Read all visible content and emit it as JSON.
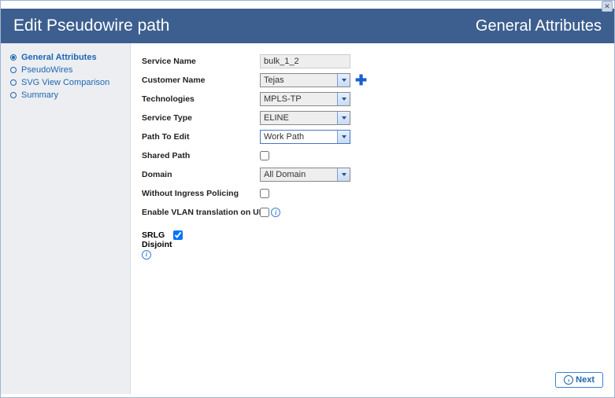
{
  "window": {
    "title": "Edit Pseudowire path",
    "section": "General Attributes"
  },
  "sidebar": {
    "items": [
      {
        "label": "General Attributes",
        "active": true
      },
      {
        "label": "PseudoWires",
        "active": false
      },
      {
        "label": "SVG View Comparison",
        "active": false
      },
      {
        "label": "Summary",
        "active": false
      }
    ]
  },
  "form": {
    "service_name": {
      "label": "Service Name",
      "value": "bulk_1_2"
    },
    "customer_name": {
      "label": "Customer Name",
      "value": "Tejas"
    },
    "technologies": {
      "label": "Technologies",
      "value": "MPLS-TP"
    },
    "service_type": {
      "label": "Service Type",
      "value": "ELINE"
    },
    "path_to_edit": {
      "label": "Path To Edit",
      "value": "Work Path"
    },
    "shared_path": {
      "label": "Shared Path",
      "checked": false
    },
    "domain": {
      "label": "Domain",
      "value": "All Domain"
    },
    "without_ingress_policing": {
      "label": "Without Ingress Policing",
      "checked": false
    },
    "enable_vlan_translation": {
      "label": "Enable VLAN translation on UNI",
      "checked": false
    },
    "srlg_disjoint": {
      "label": "SRLG Disjoint",
      "checked": true
    }
  },
  "footer": {
    "next_label": "Next"
  }
}
